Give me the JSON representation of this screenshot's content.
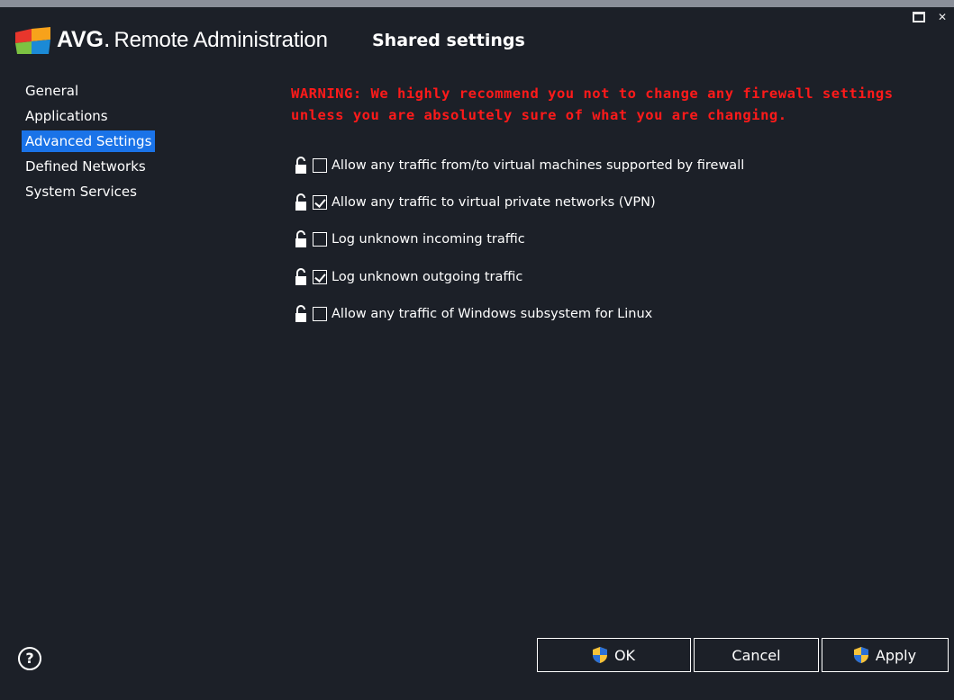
{
  "window": {
    "maximize_icon": "maximize-icon",
    "close_icon": "close-icon",
    "close_glyph": "✕"
  },
  "header": {
    "brand_bold": "AVG",
    "brand_dot": ".",
    "brand_rest": "Remote Administration",
    "page_title": "Shared settings",
    "logo_colors": [
      "#e8362c",
      "#f7a21b",
      "#7cc242",
      "#1b8ad6"
    ]
  },
  "sidebar": {
    "items": [
      {
        "label": "General",
        "active": false
      },
      {
        "label": "Applications",
        "active": false
      },
      {
        "label": "Advanced Settings",
        "active": true
      },
      {
        "label": "Defined Networks",
        "active": false
      },
      {
        "label": "System Services",
        "active": false
      }
    ]
  },
  "main": {
    "warning_line1": "WARNING: We highly recommend you not to change any firewall settings",
    "warning_line2": "unless you are absolutely sure of what you are changing.",
    "options": [
      {
        "label": "Allow any traffic from/to virtual machines supported by firewall",
        "checked": false
      },
      {
        "label": "Allow any traffic to virtual private networks (VPN)",
        "checked": true
      },
      {
        "label": "Log unknown incoming traffic",
        "checked": false
      },
      {
        "label": "Log unknown outgoing traffic",
        "checked": true
      },
      {
        "label": "Allow any traffic of Windows subsystem for Linux",
        "checked": false
      }
    ]
  },
  "footer": {
    "help_glyph": "?",
    "ok_label": "OK",
    "cancel_label": "Cancel",
    "apply_label": "Apply"
  },
  "colors": {
    "background": "#1c2028",
    "accent": "#1a73e8",
    "warning": "#ff1a1a"
  }
}
